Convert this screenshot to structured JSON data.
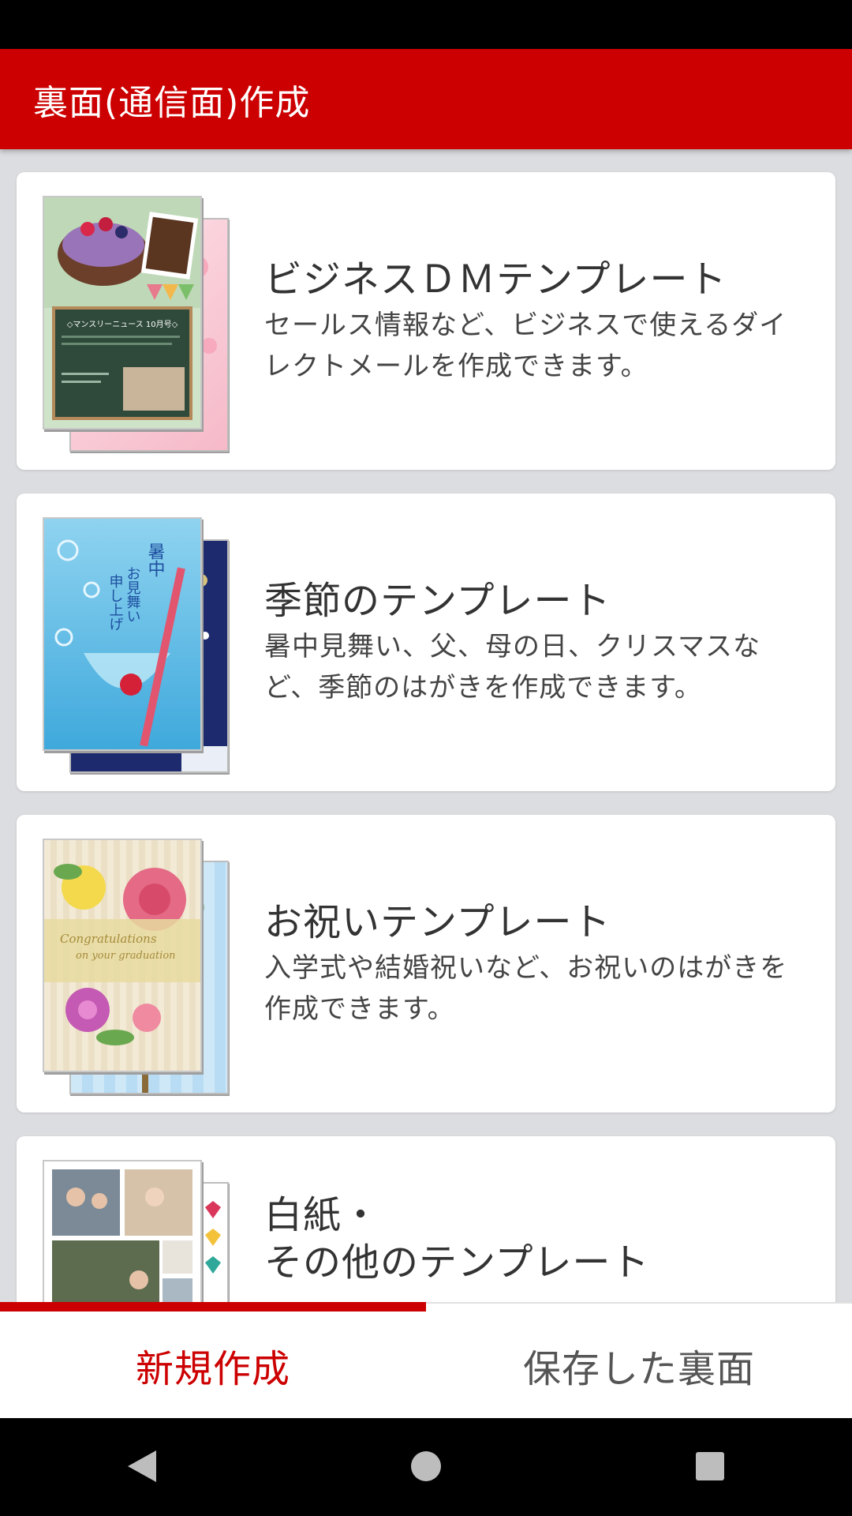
{
  "app_bar": {
    "title": "裏面(通信面)作成"
  },
  "cards": [
    {
      "title": "ビジネスＤＭテンプレート",
      "description": "セールス情報など、ビジネスで使えるダイレクトメールを作成できます。",
      "thumbnail_text": "◇マンスリーニュース 10月号◇"
    },
    {
      "title": "季節のテンプレート",
      "description": "暑中見舞い、父、母の日、クリスマスなど、季節のはがきを作成できます。",
      "thumbnail_text": "暑中お見舞い申し上げます"
    },
    {
      "title": "お祝いテンプレート",
      "description": "入学式や結婚祝いなど、お祝いのはがきを作成できます。",
      "thumbnail_text": "Congratulations on your graduation"
    },
    {
      "title": "白紙・\nその他のテンプレート",
      "description": ""
    }
  ],
  "tabs": {
    "new": "新規作成",
    "saved": "保存した裏面"
  },
  "colors": {
    "brand_red": "#cc0000",
    "background": "#dcdde0"
  }
}
